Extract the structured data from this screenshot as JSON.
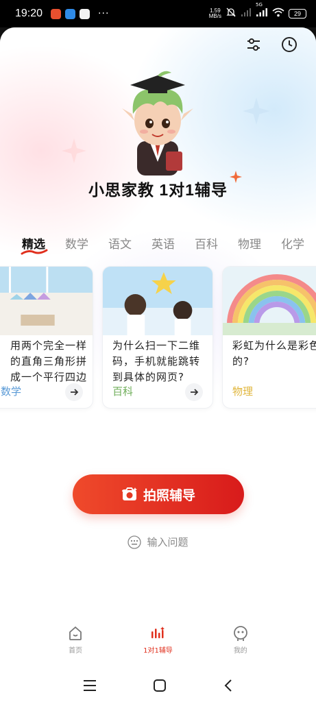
{
  "status_bar": {
    "time": "19:20",
    "more": "···",
    "net_speed_value": "1.59",
    "net_speed_unit": "MB/s",
    "signal_type": "5G",
    "battery": "29"
  },
  "header": {
    "brand_title": "小思家教  1对1辅导"
  },
  "tabs": [
    {
      "label": "精选",
      "active": true
    },
    {
      "label": "数学"
    },
    {
      "label": "语文"
    },
    {
      "label": "英语"
    },
    {
      "label": "百科"
    },
    {
      "label": "物理"
    },
    {
      "label": "化学"
    }
  ],
  "cards": [
    {
      "title": "用两个完全一样的直角三角形拼成一个平行四边形，...",
      "tag": "数学",
      "tag_color": "#5a9ad6"
    },
    {
      "title": "为什么扫一下二维码，手机就能跳转到具体的网页?",
      "tag": "百科",
      "tag_color": "#6fae5a"
    },
    {
      "title": "彩虹为什么是彩色的?",
      "tag": "物理",
      "tag_color": "#e0b53a"
    }
  ],
  "actions": {
    "photo_button": "拍照辅导",
    "input_link": "输入问题"
  },
  "bottom_nav": [
    {
      "label": "首页",
      "icon": "home-icon"
    },
    {
      "label": "1对1辅导",
      "icon": "tutoring-icon",
      "active": true
    },
    {
      "label": "我的",
      "icon": "profile-icon"
    }
  ],
  "colors": {
    "accent": "#e0301e",
    "button_start": "#ef4a2b",
    "button_end": "#d81b1b"
  }
}
